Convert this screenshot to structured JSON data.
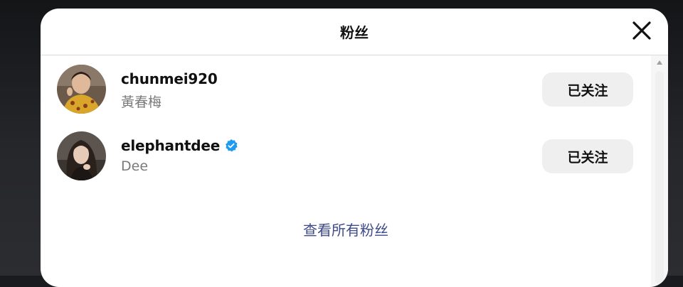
{
  "modal": {
    "title": "粉丝"
  },
  "followers": [
    {
      "username": "chunmei920",
      "full_name": "黃春梅",
      "verified": false,
      "button_label": "已关注"
    },
    {
      "username": "elephantdee",
      "full_name": "Dee",
      "verified": true,
      "button_label": "已关注"
    }
  ],
  "see_all_label": "查看所有粉丝",
  "colors": {
    "verified_badge": "#1d9bf0",
    "link": "#3e4a8a",
    "button_bg": "#efefef",
    "subtitle": "#7a7a7a"
  },
  "icons": {
    "close": "close-icon",
    "verified": "verified-badge-icon",
    "scroll_up": "scroll-up-arrow-icon"
  }
}
